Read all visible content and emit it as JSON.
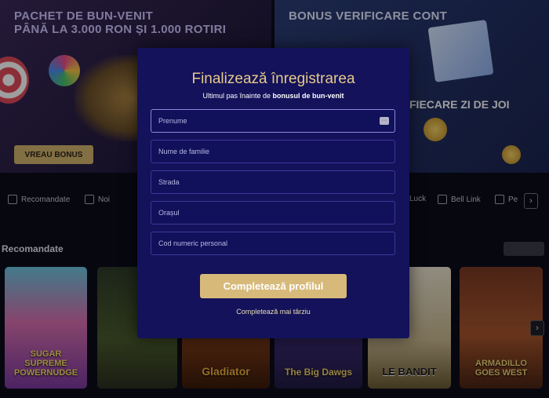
{
  "banners": {
    "left_title_line1": "PACHET DE BUN-VENIT",
    "left_title_line2": "PÂNĂ LA 3.000 RON ȘI 1.000 ROTIRI",
    "left_button": "VREAU BONUS",
    "right_title": "BONUS VERIFICARE CONT",
    "right_sub": "N FIECARE ZI DE JOI"
  },
  "categories": [
    {
      "label": "Recomandate",
      "icon": "star-icon"
    },
    {
      "label": "Noi",
      "icon": "rocket-icon"
    },
    {
      "label": "Luck",
      "icon": "clover-icon"
    },
    {
      "label": "Bell Link",
      "icon": "bell-icon"
    },
    {
      "label": "Pe",
      "icon": "diamond-icon"
    }
  ],
  "section": {
    "title": "Recomandate"
  },
  "games": [
    "SUGAR SUPREME POWERNUDGE",
    "Gladiator",
    "The Big Dawgs",
    "LE BANDIT",
    "ARMADILLO GOES WEST"
  ],
  "modal": {
    "title": "Finalizează înregistrarea",
    "subtitle_prefix": "Ultimul pas înainte de ",
    "subtitle_bold": "bonusul de bun-venit",
    "fields": {
      "first_name": "Prenume",
      "last_name": "Nume de familie",
      "street": "Strada",
      "city": "Orașul",
      "cnp": "Cod numeric personal"
    },
    "submit_label": "Completează profilul",
    "later_label": "Completează mai târziu"
  },
  "colors": {
    "modal_bg": "#13125a",
    "gold": "#d7b97a",
    "title_gold": "#e7c98b"
  }
}
